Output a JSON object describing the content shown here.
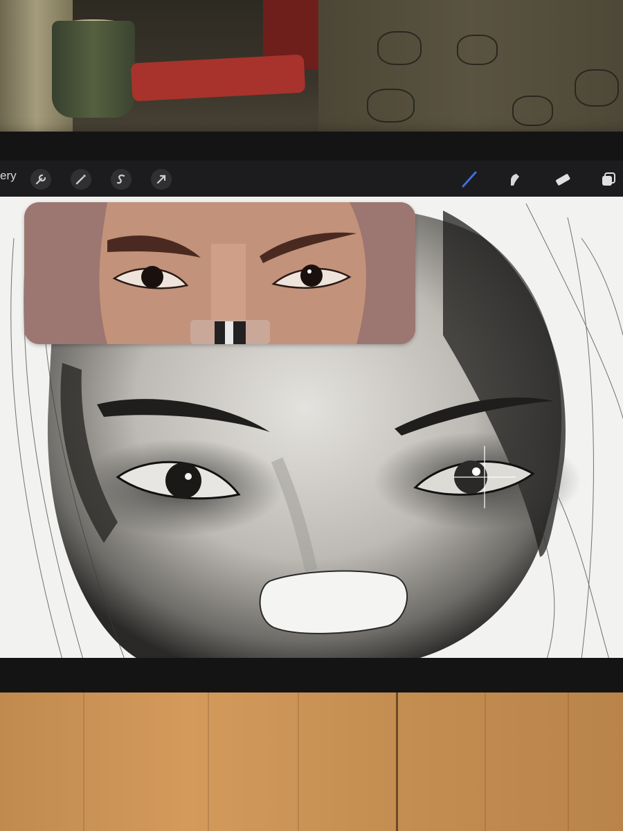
{
  "toolbar": {
    "gallery_label": "ery",
    "left_tools": [
      "actions-wrench-icon",
      "adjustments-wand-icon",
      "selection-s-icon",
      "transform-arrow-icon"
    ],
    "right_tools": [
      "brush-icon",
      "smudge-icon",
      "eraser-icon",
      "layers-icon"
    ],
    "active_tool": "brush-icon",
    "active_color": "#3d6fe0"
  },
  "canvas": {
    "reference_window": "reference-photo"
  }
}
